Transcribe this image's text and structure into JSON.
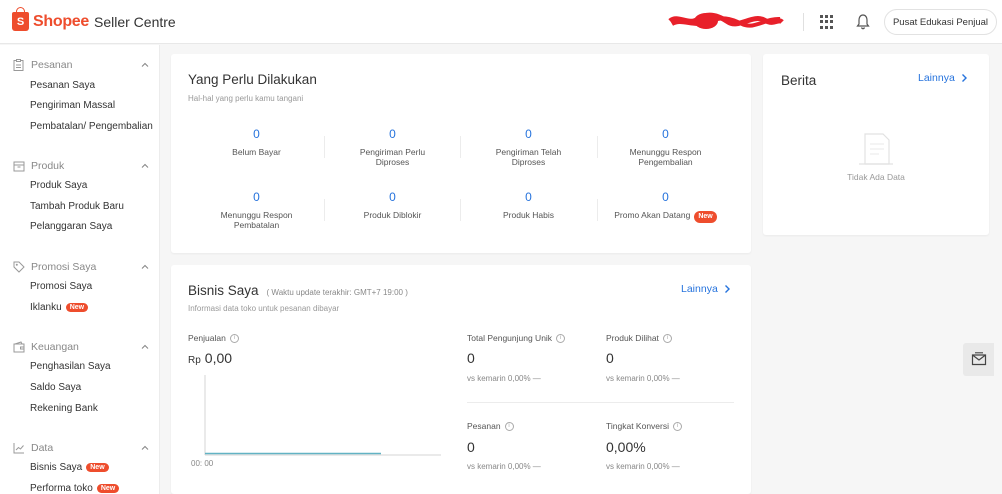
{
  "header": {
    "logo_mark": "S",
    "brand": "Shopee",
    "product": "Seller Centre",
    "edu_button": "Pusat Edukasi Penjual"
  },
  "sidebar": {
    "groups": [
      {
        "title": "Pesanan",
        "icon": "clipboard-icon",
        "items": [
          "Pesanan Saya",
          "Pengiriman Massal",
          "Pembatalan/ Pengembalian"
        ]
      },
      {
        "title": "Produk",
        "icon": "box-icon",
        "items": [
          "Produk Saya",
          "Tambah Produk Baru",
          "Pelanggaran Saya"
        ]
      },
      {
        "title": "Promosi Saya",
        "icon": "tag-icon",
        "items": [
          "Promosi Saya",
          "Iklanku"
        ]
      },
      {
        "title": "Keuangan",
        "icon": "wallet-icon",
        "items": [
          "Penghasilan Saya",
          "Saldo Saya",
          "Rekening Bank"
        ]
      },
      {
        "title": "Data",
        "icon": "chart-icon",
        "items": [
          "Bisnis Saya",
          "Performa toko"
        ]
      }
    ],
    "new_badge": "New"
  },
  "todo": {
    "title": "Yang Perlu Dilakukan",
    "subtitle": "Hal-hal yang perlu kamu tangani",
    "cells": [
      {
        "value": "0",
        "label": "Belum Bayar"
      },
      {
        "value": "0",
        "label": "Pengiriman Perlu Diproses"
      },
      {
        "value": "0",
        "label": "Pengiriman Telah Diproses"
      },
      {
        "value": "0",
        "label": "Menunggu Respon Pengembalian"
      },
      {
        "value": "0",
        "label": "Menunggu Respon Pembatalan"
      },
      {
        "value": "0",
        "label": "Produk Diblokir"
      },
      {
        "value": "0",
        "label": "Produk Habis"
      },
      {
        "value": "0",
        "label": "Promo Akan Datang"
      }
    ],
    "new_badge": "New"
  },
  "news": {
    "title": "Berita",
    "more": "Lainnya",
    "empty": "Tidak Ada Data"
  },
  "business": {
    "title": "Bisnis Saya",
    "update_note": "( Waktu update terakhir: GMT+7 19:00 )",
    "subtitle": "Informasi data toko untuk pesanan dibayar",
    "more": "Lainnya",
    "sales_label": "Penjualan",
    "sales_currency": "Rp",
    "sales_value": "0,00",
    "chart_x_label": "00: 00",
    "metrics": [
      {
        "label": "Total Pengunjung Unik",
        "value": "0",
        "cmp": "vs kemarin 0,00% —"
      },
      {
        "label": "Produk Dilihat",
        "value": "0",
        "cmp": "vs kemarin 0,00% —"
      },
      {
        "label": "Pesanan",
        "value": "0",
        "cmp": "vs kemarin 0,00% —"
      },
      {
        "label": "Tingkat Konversi",
        "value": "0,00%",
        "cmp": "vs kemarin 0,00% —"
      }
    ]
  },
  "colors": {
    "brand": "#ee4d2d",
    "link": "#2673dd"
  }
}
